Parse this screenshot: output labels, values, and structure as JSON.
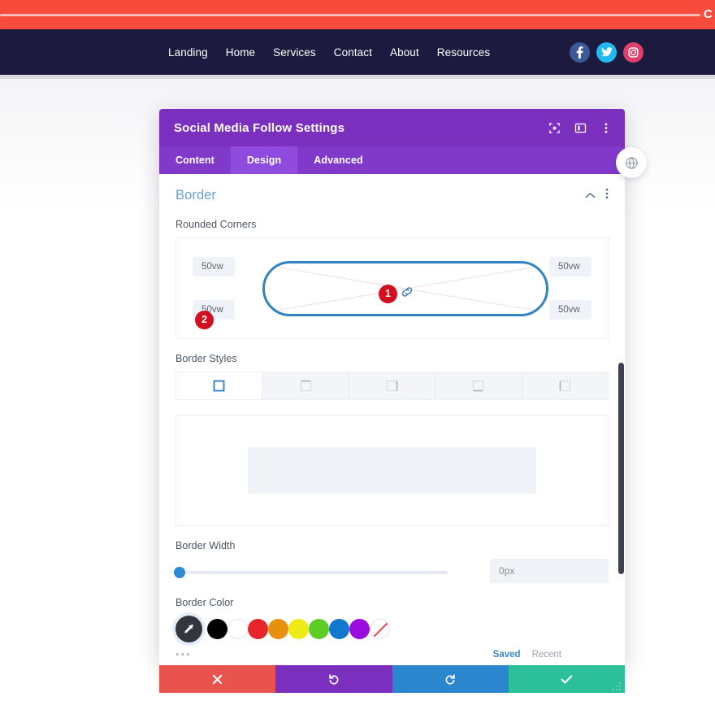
{
  "site": {
    "topbar": {
      "cut_text": "C"
    },
    "nav": {
      "items": [
        {
          "label": "Landing"
        },
        {
          "label": "Home"
        },
        {
          "label": "Services"
        },
        {
          "label": "Contact"
        },
        {
          "label": "About"
        },
        {
          "label": "Resources"
        }
      ],
      "social": [
        {
          "name": "facebook",
          "color": "#3b5998"
        },
        {
          "name": "twitter",
          "color": "#22b8f0"
        },
        {
          "name": "instagram",
          "color": "#e03f6a"
        }
      ]
    }
  },
  "modal": {
    "title": "Social Media Follow Settings",
    "header_icons": [
      {
        "name": "expand-icon"
      },
      {
        "name": "layout-icon"
      },
      {
        "name": "more-icon"
      }
    ],
    "tabs": [
      {
        "label": "Content",
        "active": false
      },
      {
        "label": "Design",
        "active": true
      },
      {
        "label": "Advanced",
        "active": false
      }
    ],
    "section": {
      "title": "Border",
      "collapse_icon": "chevron-up-icon",
      "menu_icon": "more-vertical-icon"
    },
    "rounded_corners": {
      "label": "Rounded Corners",
      "top_left": "50vw",
      "top_right": "50vw",
      "bottom_left": "50vw",
      "bottom_right": "50vw",
      "link_icon": "link-icon",
      "preview_border_color": "#3183c2"
    },
    "annotations": [
      {
        "number": "1",
        "color": "#d10f1e"
      },
      {
        "number": "2",
        "color": "#d10f1e"
      }
    ],
    "border_styles": {
      "label": "Border Styles",
      "options": [
        {
          "name": "border-all",
          "active": true
        },
        {
          "name": "border-top",
          "active": false
        },
        {
          "name": "border-right",
          "active": false
        },
        {
          "name": "border-bottom",
          "active": false
        },
        {
          "name": "border-left",
          "active": false
        }
      ]
    },
    "border_width": {
      "label": "Border Width",
      "value": "0px",
      "slider_position": 0
    },
    "border_color": {
      "label": "Border Color",
      "swatches": [
        {
          "name": "eyedropper",
          "color": "#33363b",
          "selected": true
        },
        {
          "name": "black",
          "color": "#000000",
          "selected": false
        },
        {
          "name": "white",
          "color": "#ffffff",
          "selected": false
        },
        {
          "name": "red",
          "color": "#e8252a",
          "selected": false
        },
        {
          "name": "orange",
          "color": "#e8900d",
          "selected": false
        },
        {
          "name": "yellow",
          "color": "#eeea13",
          "selected": false
        },
        {
          "name": "green",
          "color": "#5fcc26",
          "selected": false
        },
        {
          "name": "blue",
          "color": "#1177cf",
          "selected": false
        },
        {
          "name": "purple",
          "color": "#9b0ce0",
          "selected": false
        },
        {
          "name": "transparent",
          "color": "transparent",
          "selected": false
        }
      ],
      "more_label": "•••",
      "tabs": [
        {
          "label": "Saved",
          "active": true
        },
        {
          "label": "Recent",
          "active": false
        }
      ]
    },
    "footer": {
      "cancel": {
        "name": "cancel-button",
        "color": "#e8534e"
      },
      "undo": {
        "name": "undo-button",
        "color": "#7b2fbe"
      },
      "redo": {
        "name": "redo-button",
        "color": "#2a86cd"
      },
      "save": {
        "name": "save-button",
        "color": "#2bbf9a"
      }
    }
  }
}
